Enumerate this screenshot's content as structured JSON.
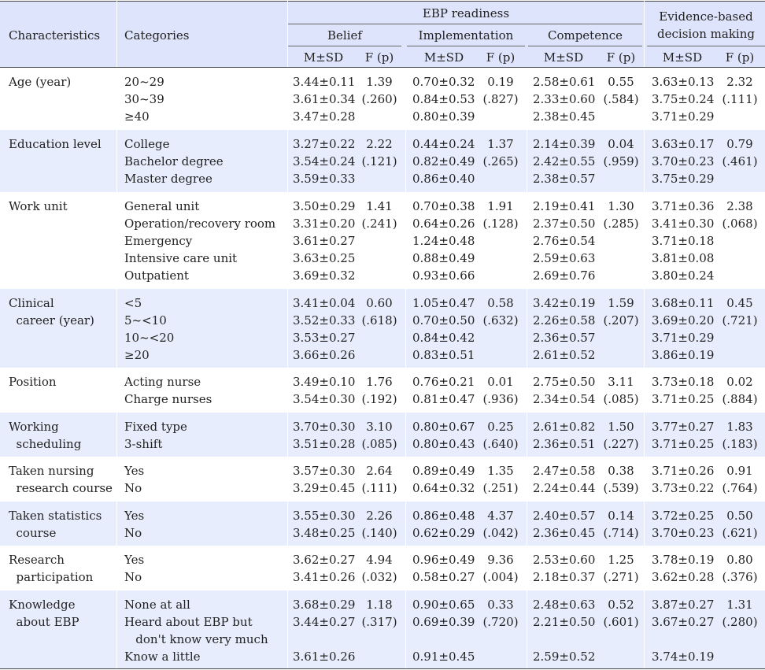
{
  "header": {
    "characteristics": "Characteristics",
    "categories": "Categories",
    "ebp_readiness": "EBP readiness",
    "belief": "Belief",
    "implementation": "Implementation",
    "competence": "Competence",
    "ebdm_line1": "Evidence-based",
    "ebdm_line2": "decision making",
    "msd": "M±SD",
    "fp": "F (p)"
  },
  "rows": [
    {
      "characteristic": "Age (year)",
      "categories": [
        "20~29",
        "30~39",
        "≥40"
      ],
      "belief": [
        "3.44±0.11",
        "3.61±0.34",
        "3.47±0.28"
      ],
      "belief_f": [
        "1.39",
        "(.260)"
      ],
      "impl": [
        "0.70±0.32",
        "0.84±0.53",
        "0.80±0.39"
      ],
      "impl_f": [
        "0.19",
        "(.827)"
      ],
      "comp": [
        "2.58±0.61",
        "2.33±0.60",
        "2.38±0.45"
      ],
      "comp_f": [
        "0.55",
        "(.584)"
      ],
      "ebdm": [
        "3.63±0.13",
        "3.75±0.24",
        "3.71±0.29"
      ],
      "ebdm_f": [
        "2.32",
        "(.111)"
      ]
    },
    {
      "characteristic": "Education level",
      "categories": [
        "College",
        "Bachelor degree",
        "Master degree"
      ],
      "belief": [
        "3.27±0.22",
        "3.54±0.24",
        "3.59±0.33"
      ],
      "belief_f": [
        "2.22",
        "(.121)"
      ],
      "impl": [
        "0.44±0.24",
        "0.82±0.49",
        "0.86±0.40"
      ],
      "impl_f": [
        "1.37",
        "(.265)"
      ],
      "comp": [
        "2.14±0.39",
        "2.42±0.55",
        "2.38±0.57"
      ],
      "comp_f": [
        "0.04",
        "(.959)"
      ],
      "ebdm": [
        "3.63±0.17",
        "3.70±0.23",
        "3.75±0.29"
      ],
      "ebdm_f": [
        "0.79",
        "(.461)"
      ]
    },
    {
      "characteristic": "Work unit",
      "categories": [
        "General unit",
        "Operation/recovery room",
        "Emergency",
        "Intensive care unit",
        "Outpatient"
      ],
      "belief": [
        "3.50±0.29",
        "3.31±0.20",
        "3.61±0.27",
        "3.63±0.25",
        "3.69±0.32"
      ],
      "belief_f": [
        "1.41",
        "(.241)"
      ],
      "impl": [
        "0.70±0.38",
        "0.64±0.26",
        "1.24±0.48",
        "0.88±0.49",
        "0.93±0.66"
      ],
      "impl_f": [
        "1.91",
        "(.128)"
      ],
      "comp": [
        "2.19±0.41",
        "2.37±0.50",
        "2.76±0.54",
        "2.59±0.63",
        "2.69±0.76"
      ],
      "comp_f": [
        "1.30",
        "(.285)"
      ],
      "ebdm": [
        "3.71±0.36",
        "3.41±0.30",
        "3.71±0.18",
        "3.81±0.08",
        "3.80±0.24"
      ],
      "ebdm_f": [
        "2.38",
        "(.068)"
      ]
    },
    {
      "characteristic": "Clinical\n  career (year)",
      "categories": [
        "<5",
        "5~<10",
        "10~<20",
        "≥20"
      ],
      "belief": [
        "3.41±0.04",
        "3.52±0.33",
        "3.53±0.27",
        "3.66±0.26"
      ],
      "belief_f": [
        "0.60",
        "(.618)"
      ],
      "impl": [
        "1.05±0.47",
        "0.70±0.50",
        "0.84±0.42",
        "0.83±0.51"
      ],
      "impl_f": [
        "0.58",
        "(.632)"
      ],
      "comp": [
        "3.42±0.19",
        "2.26±0.58",
        "2.36±0.57",
        "2.61±0.52"
      ],
      "comp_f": [
        "1.59",
        "(.207)"
      ],
      "ebdm": [
        "3.68±0.11",
        "3.69±0.20",
        "3.71±0.29",
        "3.86±0.19"
      ],
      "ebdm_f": [
        "0.45",
        "(.721)"
      ]
    },
    {
      "characteristic": "Position",
      "categories": [
        "Acting nurse",
        "Charge nurses"
      ],
      "belief": [
        "3.49±0.10",
        "3.54±0.30"
      ],
      "belief_f": [
        "1.76",
        "(.192)"
      ],
      "impl": [
        "0.76±0.21",
        "0.81±0.47"
      ],
      "impl_f": [
        "0.01",
        "(.936)"
      ],
      "comp": [
        "2.75±0.50",
        "2.34±0.54"
      ],
      "comp_f": [
        "3.11",
        "(.085)"
      ],
      "ebdm": [
        "3.73±0.18",
        "3.71±0.25"
      ],
      "ebdm_f": [
        "0.02",
        "(.884)"
      ]
    },
    {
      "characteristic": "Working\n  scheduling",
      "categories": [
        "Fixed type",
        "3-shift"
      ],
      "belief": [
        "3.70±0.30",
        "3.51±0.28"
      ],
      "belief_f": [
        "3.10",
        "(.085)"
      ],
      "impl": [
        "0.80±0.67",
        "0.80±0.43"
      ],
      "impl_f": [
        "0.25",
        "(.640)"
      ],
      "comp": [
        "2.61±0.82",
        "2.36±0.51"
      ],
      "comp_f": [
        "1.50",
        "(.227)"
      ],
      "ebdm": [
        "3.77±0.27",
        "3.71±0.25"
      ],
      "ebdm_f": [
        "1.83",
        "(.183)"
      ]
    },
    {
      "characteristic": "Taken nursing\n  research course",
      "categories": [
        "Yes",
        "No"
      ],
      "belief": [
        "3.57±0.30",
        "3.29±0.45"
      ],
      "belief_f": [
        "2.64",
        "(.111)"
      ],
      "impl": [
        "0.89±0.49",
        "0.64±0.32"
      ],
      "impl_f": [
        "1.35",
        "(.251)"
      ],
      "comp": [
        "2.47±0.58",
        "2.24±0.44"
      ],
      "comp_f": [
        "0.38",
        "(.539)"
      ],
      "ebdm": [
        "3.71±0.26",
        "3.73±0.22"
      ],
      "ebdm_f": [
        "0.91",
        "(.764)"
      ]
    },
    {
      "characteristic": "Taken statistics\n  course",
      "categories": [
        "Yes",
        "No"
      ],
      "belief": [
        "3.55±0.30",
        "3.48±0.25"
      ],
      "belief_f": [
        "2.26",
        "(.140)"
      ],
      "impl": [
        "0.86±0.48",
        "0.62±0.29"
      ],
      "impl_f": [
        "4.37",
        "(.042)"
      ],
      "comp": [
        "2.40±0.57",
        "2.36±0.45"
      ],
      "comp_f": [
        "0.14",
        "(.714)"
      ],
      "ebdm": [
        "3.72±0.25",
        "3.70±0.23"
      ],
      "ebdm_f": [
        "0.50",
        "(.621)"
      ]
    },
    {
      "characteristic": "Research\n  participation",
      "categories": [
        "Yes",
        "No"
      ],
      "belief": [
        "3.62±0.27",
        "3.41±0.26"
      ],
      "belief_f": [
        "4.94",
        "(.032)"
      ],
      "impl": [
        "0.96±0.49",
        "0.58±0.27"
      ],
      "impl_f": [
        "9.36",
        "(.004)"
      ],
      "comp": [
        "2.53±0.60",
        "2.18±0.37"
      ],
      "comp_f": [
        "1.25",
        "(.271)"
      ],
      "ebdm": [
        "3.78±0.19",
        "3.62±0.28"
      ],
      "ebdm_f": [
        "0.80",
        "(.376)"
      ]
    },
    {
      "characteristic": "Knowledge\n  about EBP",
      "categories": [
        "None at all",
        "Heard about EBP but",
        "   don't know very much",
        "Know a little"
      ],
      "belief": [
        "3.68±0.29",
        "3.44±0.27",
        "",
        "3.61±0.26"
      ],
      "belief_f": [
        "1.18",
        "(.317)"
      ],
      "impl": [
        "0.90±0.65",
        "0.69±0.39",
        "",
        "0.91±0.45"
      ],
      "impl_f": [
        "0.33",
        "(.720)"
      ],
      "comp": [
        "2.48±0.63",
        "2.21±0.50",
        "",
        "2.59±0.52"
      ],
      "comp_f": [
        "0.52",
        "(.601)"
      ],
      "ebdm": [
        "3.87±0.27",
        "3.67±0.27",
        "",
        "3.74±0.19"
      ],
      "ebdm_f": [
        "1.31",
        "(.280)"
      ]
    }
  ]
}
